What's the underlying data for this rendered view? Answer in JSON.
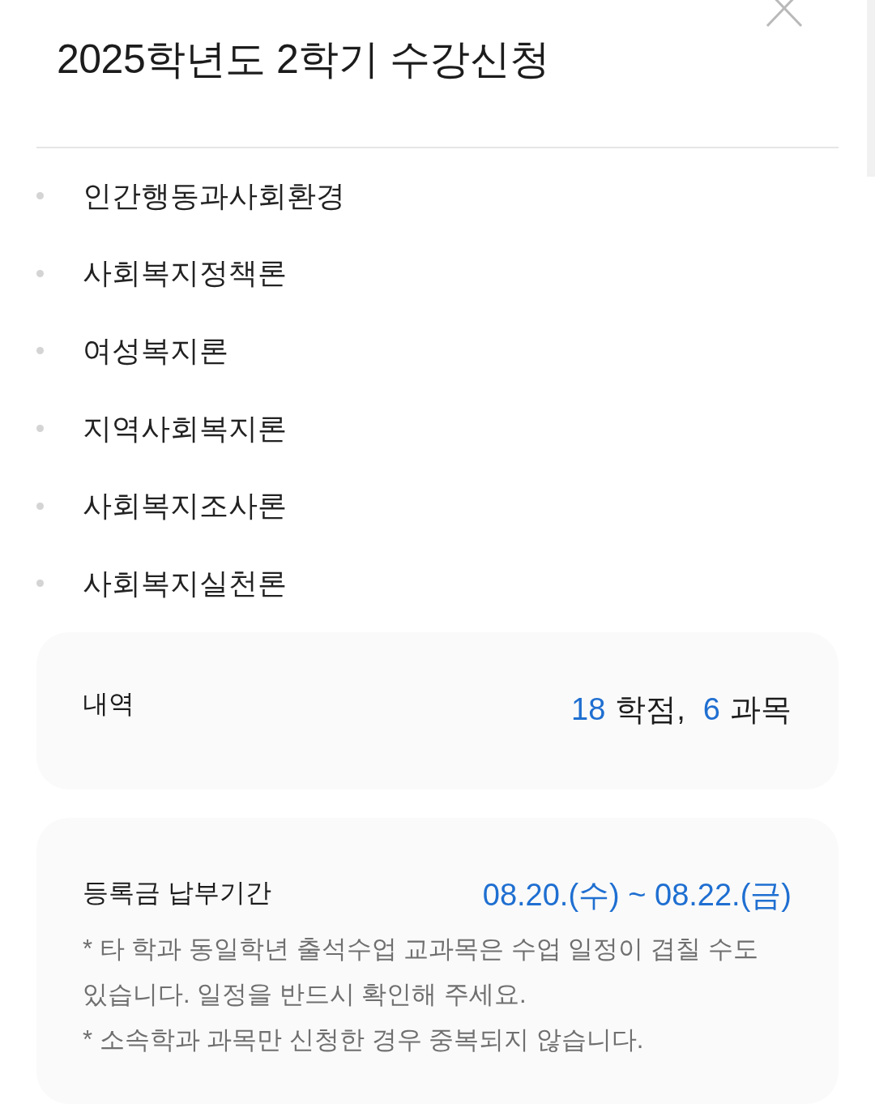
{
  "header": {
    "title": "2025학년도 2학기 수강신청"
  },
  "courses": [
    "인간행동과사회환경",
    "사회복지정책론",
    "여성복지론",
    "지역사회복지론",
    "사회복지조사론",
    "사회복지실천론"
  ],
  "summary": {
    "label": "내역",
    "totals": [
      {
        "value": "18",
        "unit": "학점,"
      },
      {
        "value": "6",
        "unit": "과목"
      }
    ]
  },
  "payment": {
    "label": "등록금 납부기간",
    "period": "08.20.(수) ~ 08.22.(금)",
    "notes": [
      "* 타 학과 동일학년 출석수업 교과목은 수업 일정이 겹칠 수도 있습니다. 일정을 반드시 확인해 주세요.",
      "* 소속학과 과목만 신청한 경우 중복되지 않습니다."
    ]
  }
}
